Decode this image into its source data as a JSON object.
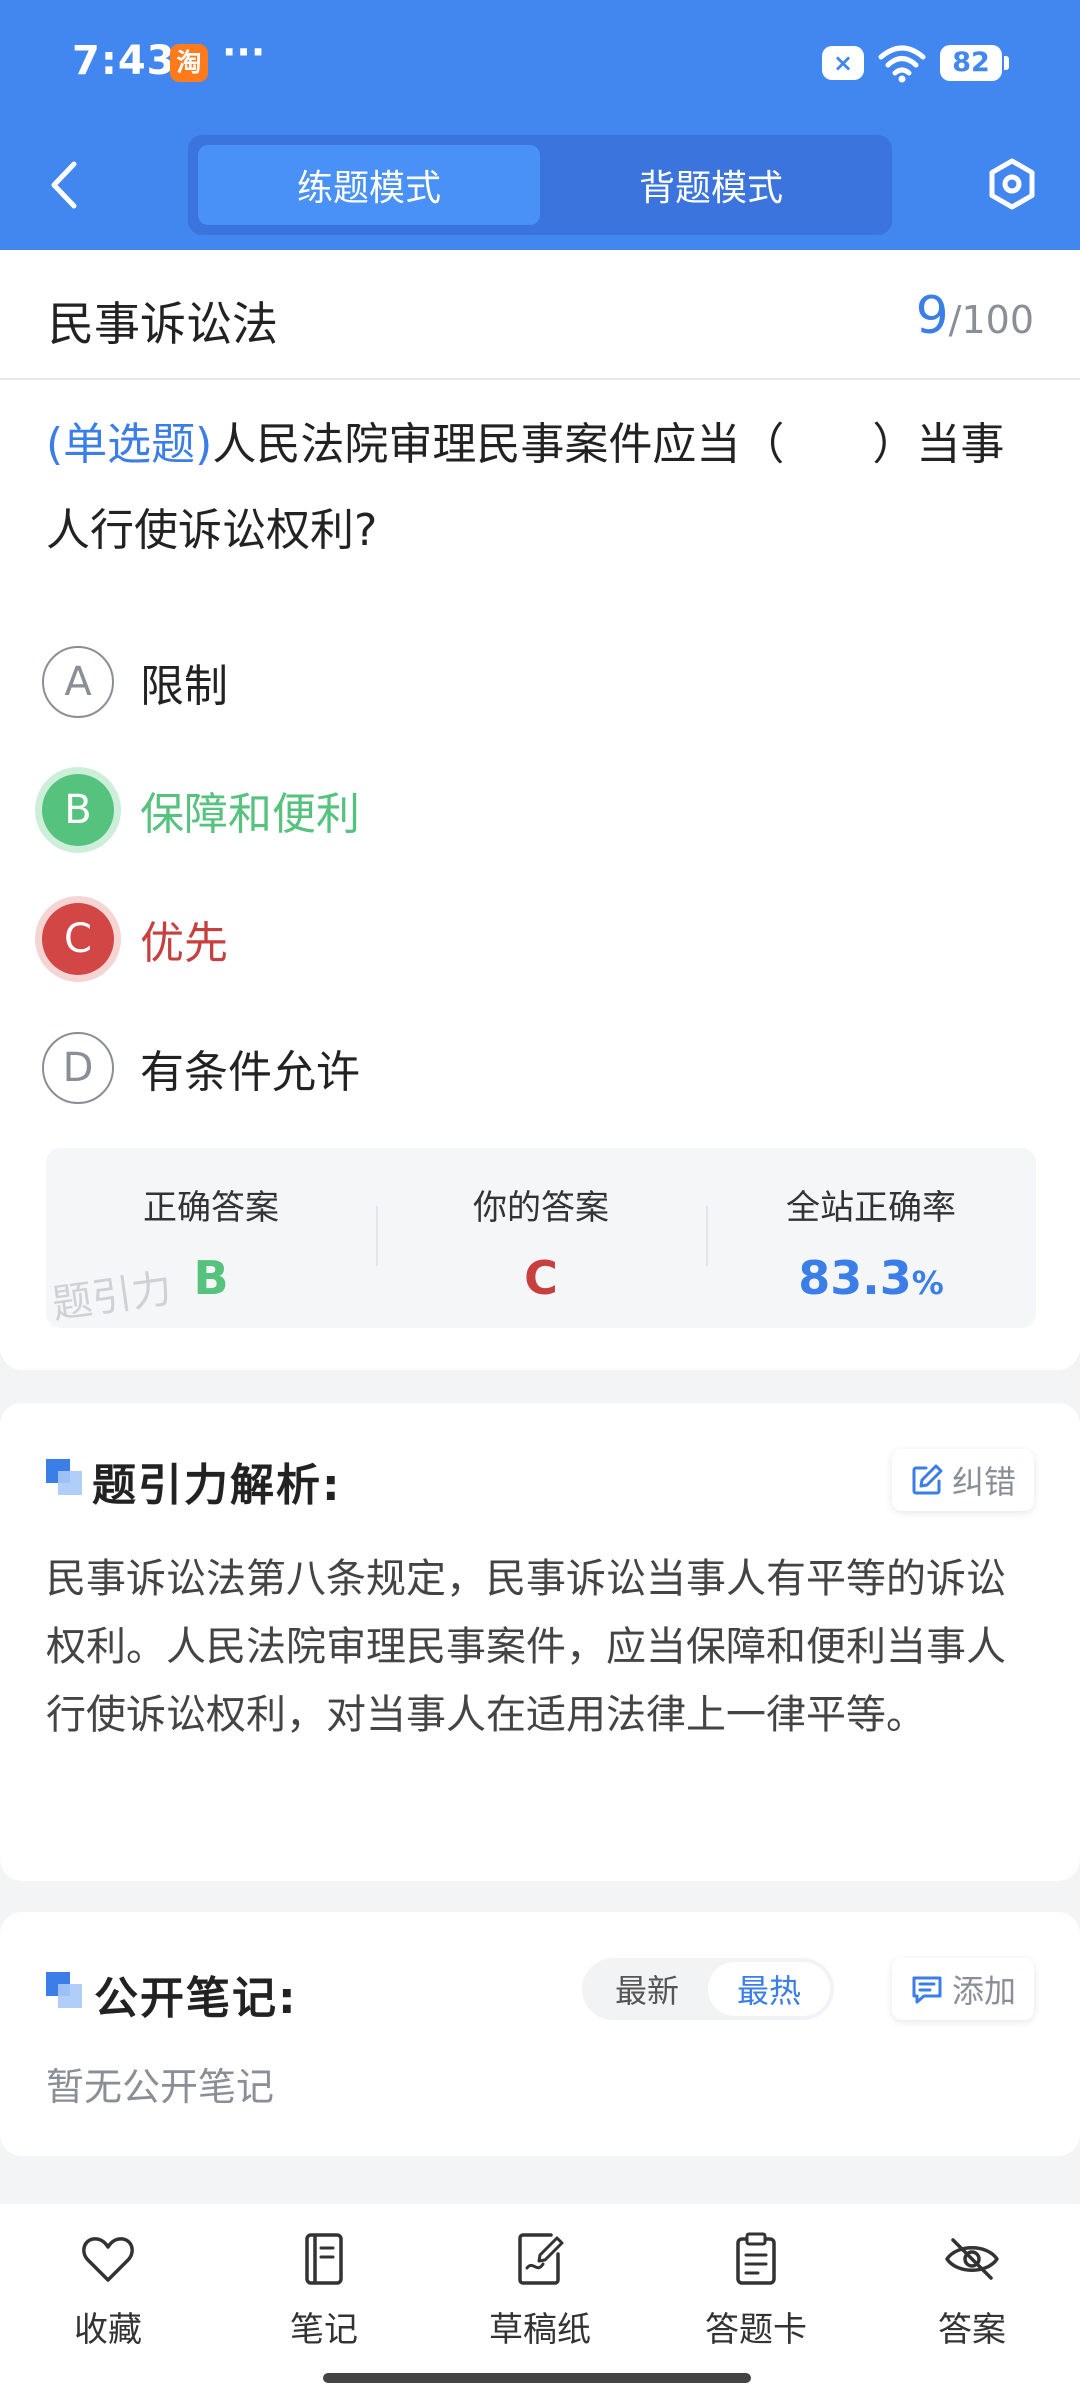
{
  "status_bar": {
    "time": "7:43",
    "taobao_badge": "淘",
    "more_dots": "···",
    "close_badge": "×",
    "battery": "82"
  },
  "header": {
    "modes": [
      {
        "label": "练题模式",
        "active": true
      },
      {
        "label": "背题模式",
        "active": false
      }
    ]
  },
  "question": {
    "subject": "民事诉讼法",
    "current": "9",
    "total": "/100",
    "type": "(单选题)",
    "text": "人民法院审理民事案件应当（　　）当事人行使诉讼权利?",
    "options": [
      {
        "letter": "A",
        "text": "限制",
        "state": "normal"
      },
      {
        "letter": "B",
        "text": "保障和便利",
        "state": "correct"
      },
      {
        "letter": "C",
        "text": "优先",
        "state": "wrong"
      },
      {
        "letter": "D",
        "text": "有条件允许",
        "state": "normal"
      }
    ],
    "result": {
      "correct_label": "正确答案",
      "correct_value": "B",
      "yours_label": "你的答案",
      "yours_value": "C",
      "rate_label": "全站正确率",
      "rate_value": "83.3",
      "rate_unit": "%",
      "watermark": "题引力"
    }
  },
  "analysis": {
    "title": "题引力解析:",
    "report_label": "纠错",
    "text": "民事诉讼法第八条规定，民事诉讼当事人有平等的诉讼权利。人民法院审理民事案件，应当保障和便利当事人行使诉讼权利，对当事人在适用法律上一律平等。"
  },
  "notes": {
    "title": "公开笔记:",
    "sort_latest": "最新",
    "sort_hot": "最热",
    "add_label": "添加",
    "empty_text": "暂无公开笔记"
  },
  "bottom_bar": {
    "items": [
      {
        "label": "收藏",
        "icon": "heart-icon"
      },
      {
        "label": "笔记",
        "icon": "notebook-icon"
      },
      {
        "label": "草稿纸",
        "icon": "draft-icon"
      },
      {
        "label": "答题卡",
        "icon": "clipboard-icon"
      },
      {
        "label": "答案",
        "icon": "eye-off-icon"
      }
    ]
  },
  "colors": {
    "brand_blue": "#4286f0",
    "accent_blue": "#3b7ee8",
    "correct_green": "#55c27e",
    "wrong_red": "#d24745"
  }
}
